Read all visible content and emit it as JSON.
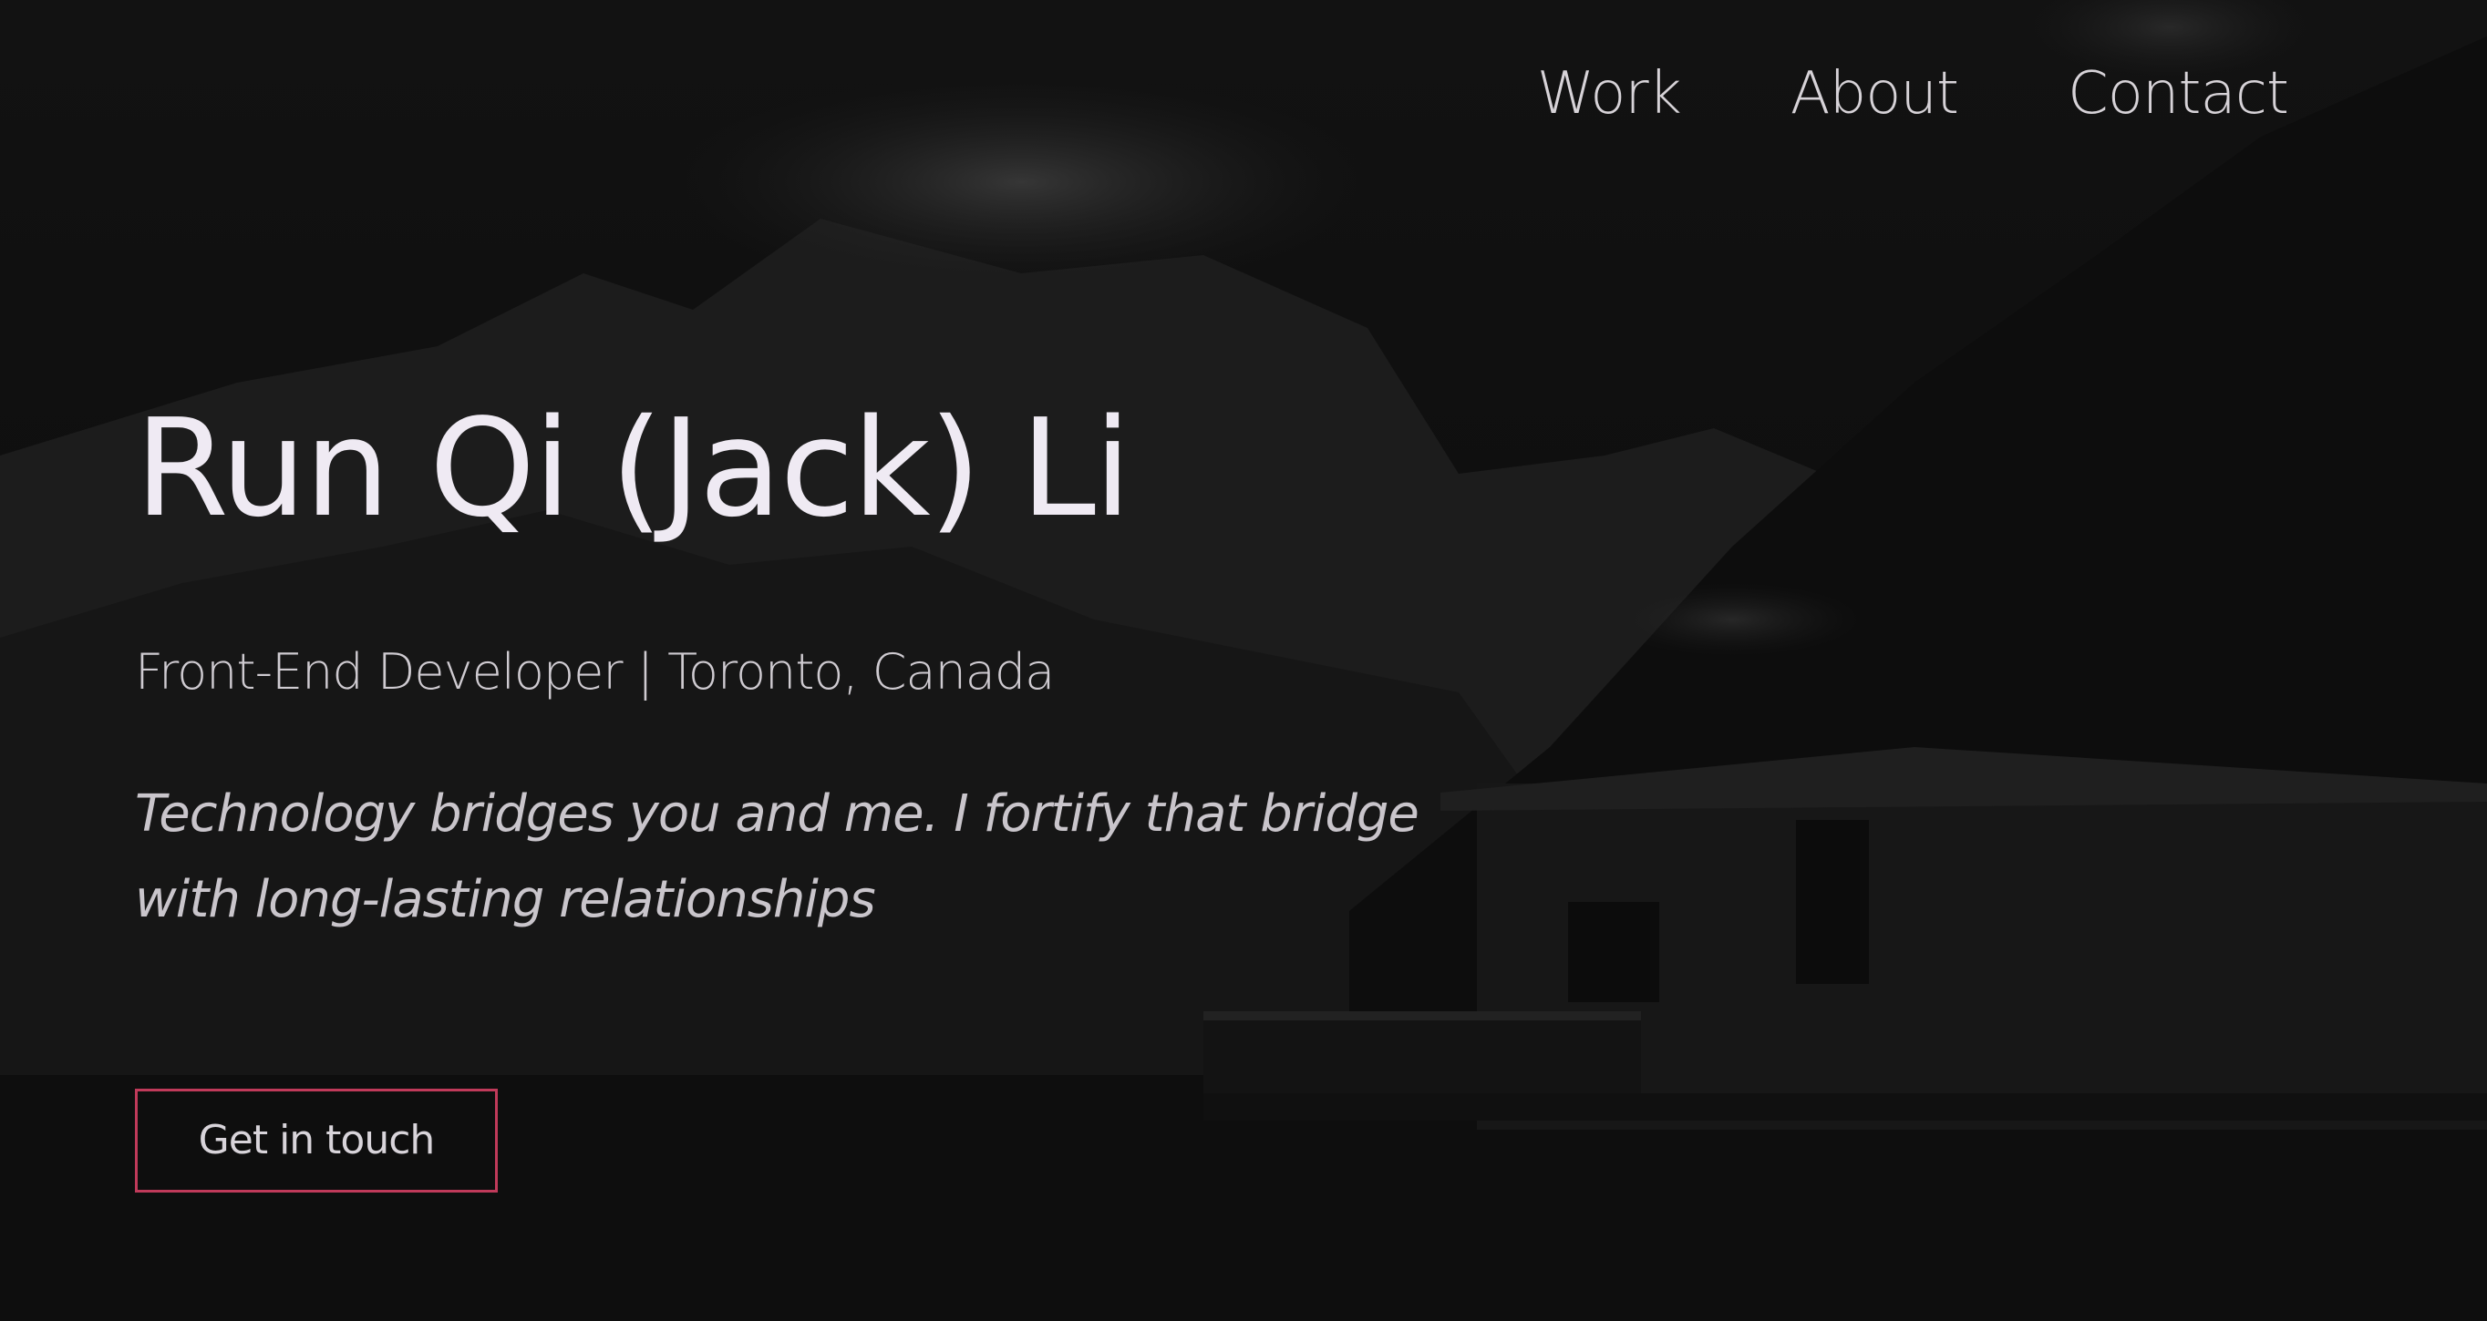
{
  "nav": {
    "items": [
      {
        "label": "Work"
      },
      {
        "label": "About"
      },
      {
        "label": "Contact"
      }
    ]
  },
  "hero": {
    "title": "Run Qi (Jack) Li",
    "subtitle": "Front-End Developer | Toronto, Canada",
    "tagline": "Technology bridges you and me. I fortify that bridge with long-lasting relationships",
    "cta_label": "Get in touch"
  },
  "colors": {
    "background": "#0b0b0b",
    "accent_border": "#c03a5a",
    "text": "#ece8ee"
  }
}
